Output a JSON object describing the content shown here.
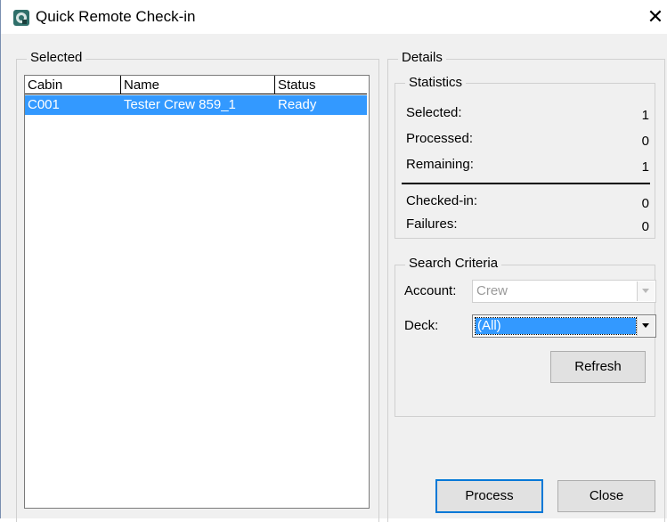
{
  "window": {
    "title": "Quick Remote Check-in",
    "close_glyph": "✕"
  },
  "selected": {
    "group_label": "Selected",
    "columns": [
      "Cabin",
      "Name",
      "Status"
    ],
    "rows": [
      {
        "cabin": "C001",
        "name": "Tester Crew 859_1",
        "status": "Ready"
      }
    ]
  },
  "details": {
    "group_label": "Details",
    "statistics": {
      "label": "Statistics",
      "selected_label": "Selected:",
      "selected_value": "1",
      "processed_label": "Processed:",
      "processed_value": "0",
      "remaining_label": "Remaining:",
      "remaining_value": "1",
      "checkedin_label": "Checked-in:",
      "checkedin_value": "0",
      "failures_label": "Failures:",
      "failures_value": "0"
    },
    "search": {
      "label": "Search Criteria",
      "account_label": "Account:",
      "account_value": "Crew",
      "deck_label": "Deck:",
      "deck_value": "(All)",
      "refresh_label": "Refresh"
    }
  },
  "buttons": {
    "process_label": "Process",
    "close_label": "Close"
  },
  "colors": {
    "selection": "#3399ff",
    "background": "#f0f0f0"
  }
}
